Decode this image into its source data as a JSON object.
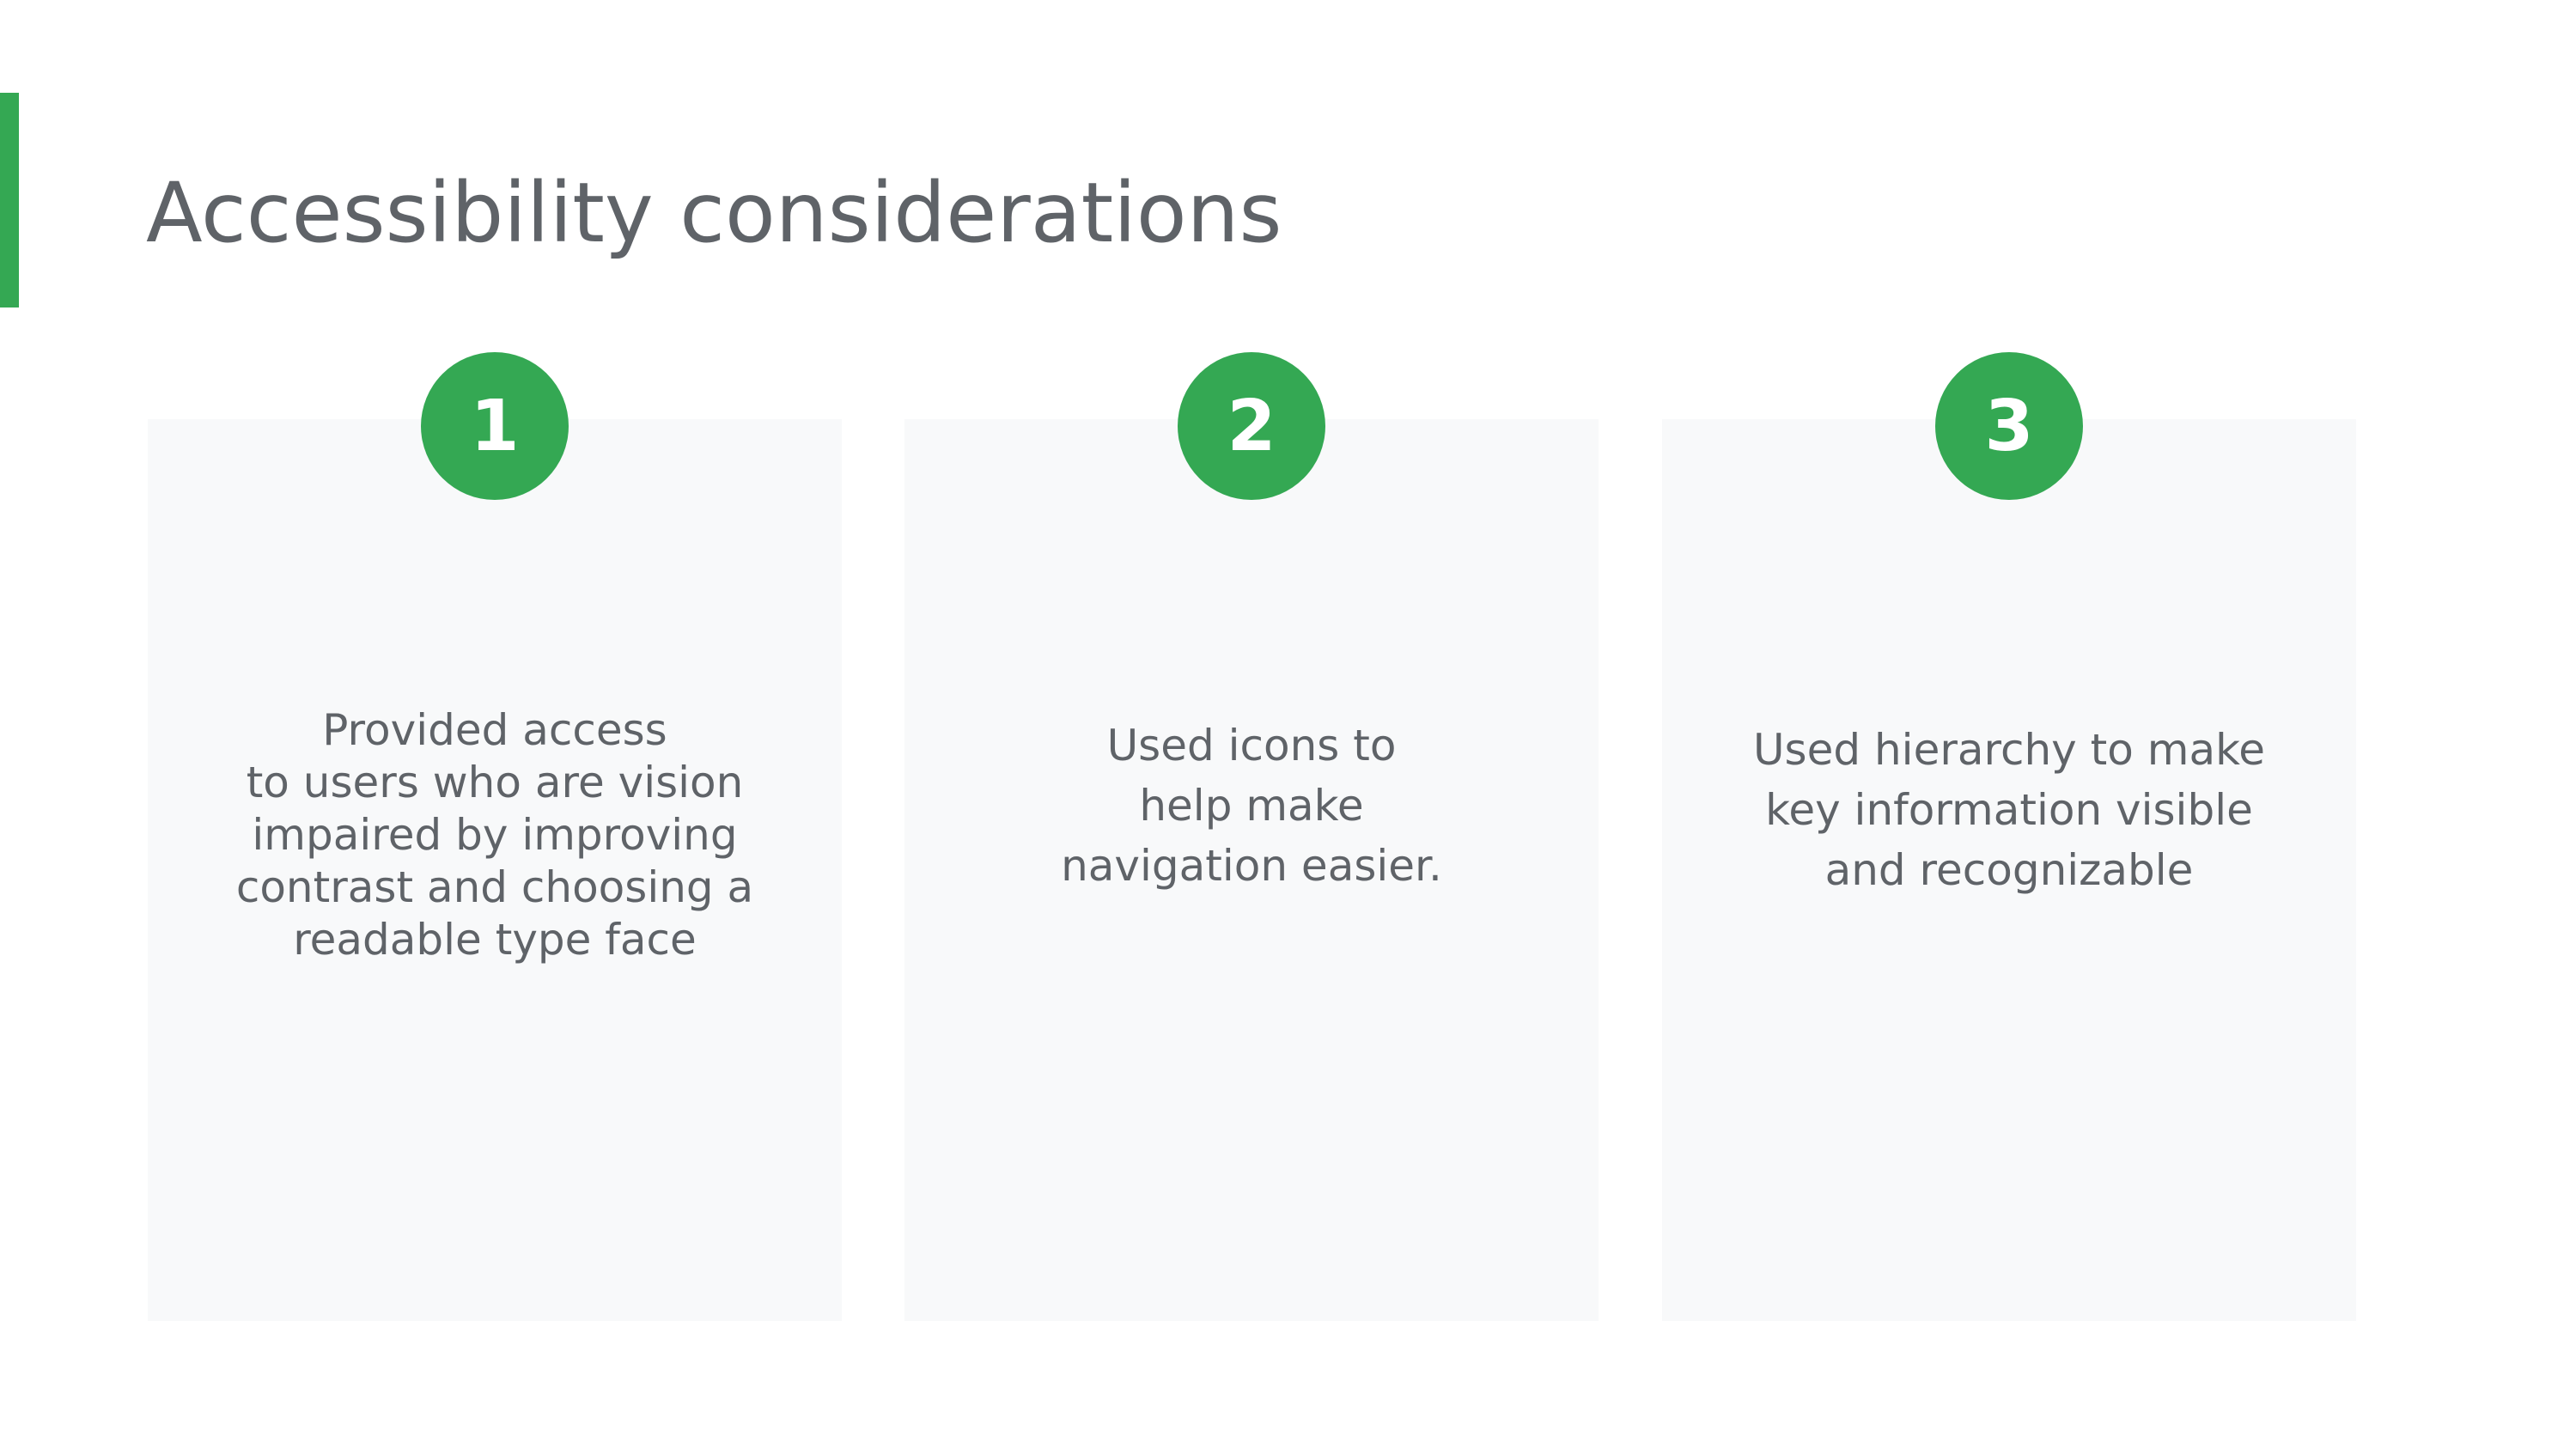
{
  "slide": {
    "title": "Accessibility considerations",
    "accent_color": "#34a853",
    "cards": [
      {
        "number": "1",
        "text": "Provided access\nto users who are vision\nimpaired by improving\ncontrast and choosing a\nreadable type face"
      },
      {
        "number": "2",
        "text": "Used icons to\nhelp make\nnavigation easier."
      },
      {
        "number": "3",
        "text": "Used hierarchy to make\nkey information visible\nand recognizable"
      }
    ]
  }
}
